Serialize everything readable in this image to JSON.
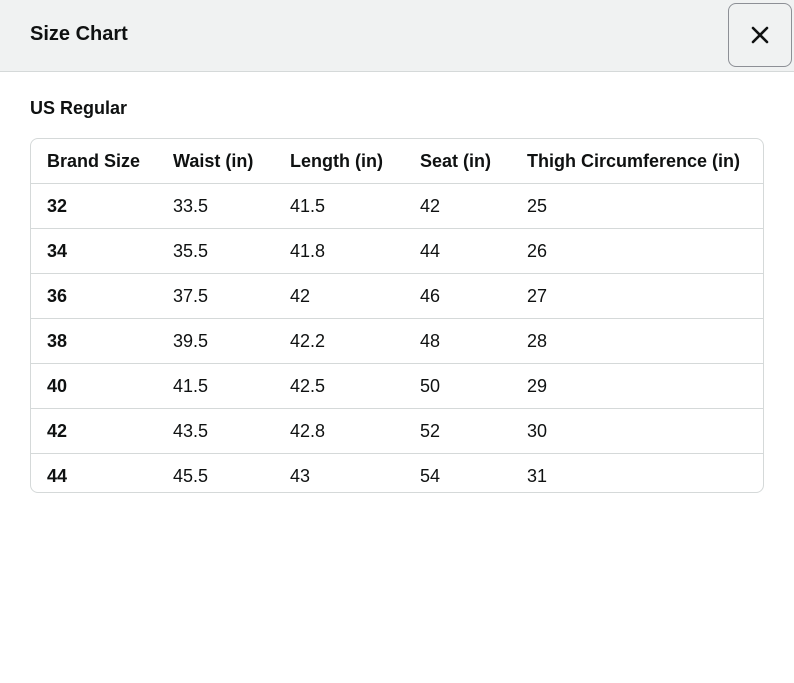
{
  "header": {
    "title": "Size Chart",
    "close_icon": "close-icon"
  },
  "section_title": "US Regular",
  "table": {
    "columns": [
      "Brand Size",
      "Waist (in)",
      "Length (in)",
      "Seat (in)",
      "Thigh Circumference (in)"
    ],
    "rows": [
      [
        "32",
        "33.5",
        "41.5",
        "42",
        "25"
      ],
      [
        "34",
        "35.5",
        "41.8",
        "44",
        "26"
      ],
      [
        "36",
        "37.5",
        "42",
        "46",
        "27"
      ],
      [
        "38",
        "39.5",
        "42.2",
        "48",
        "28"
      ],
      [
        "40",
        "41.5",
        "42.5",
        "50",
        "29"
      ],
      [
        "42",
        "43.5",
        "42.8",
        "52",
        "30"
      ],
      [
        "44",
        "45.5",
        "43",
        "54",
        "31"
      ]
    ]
  }
}
